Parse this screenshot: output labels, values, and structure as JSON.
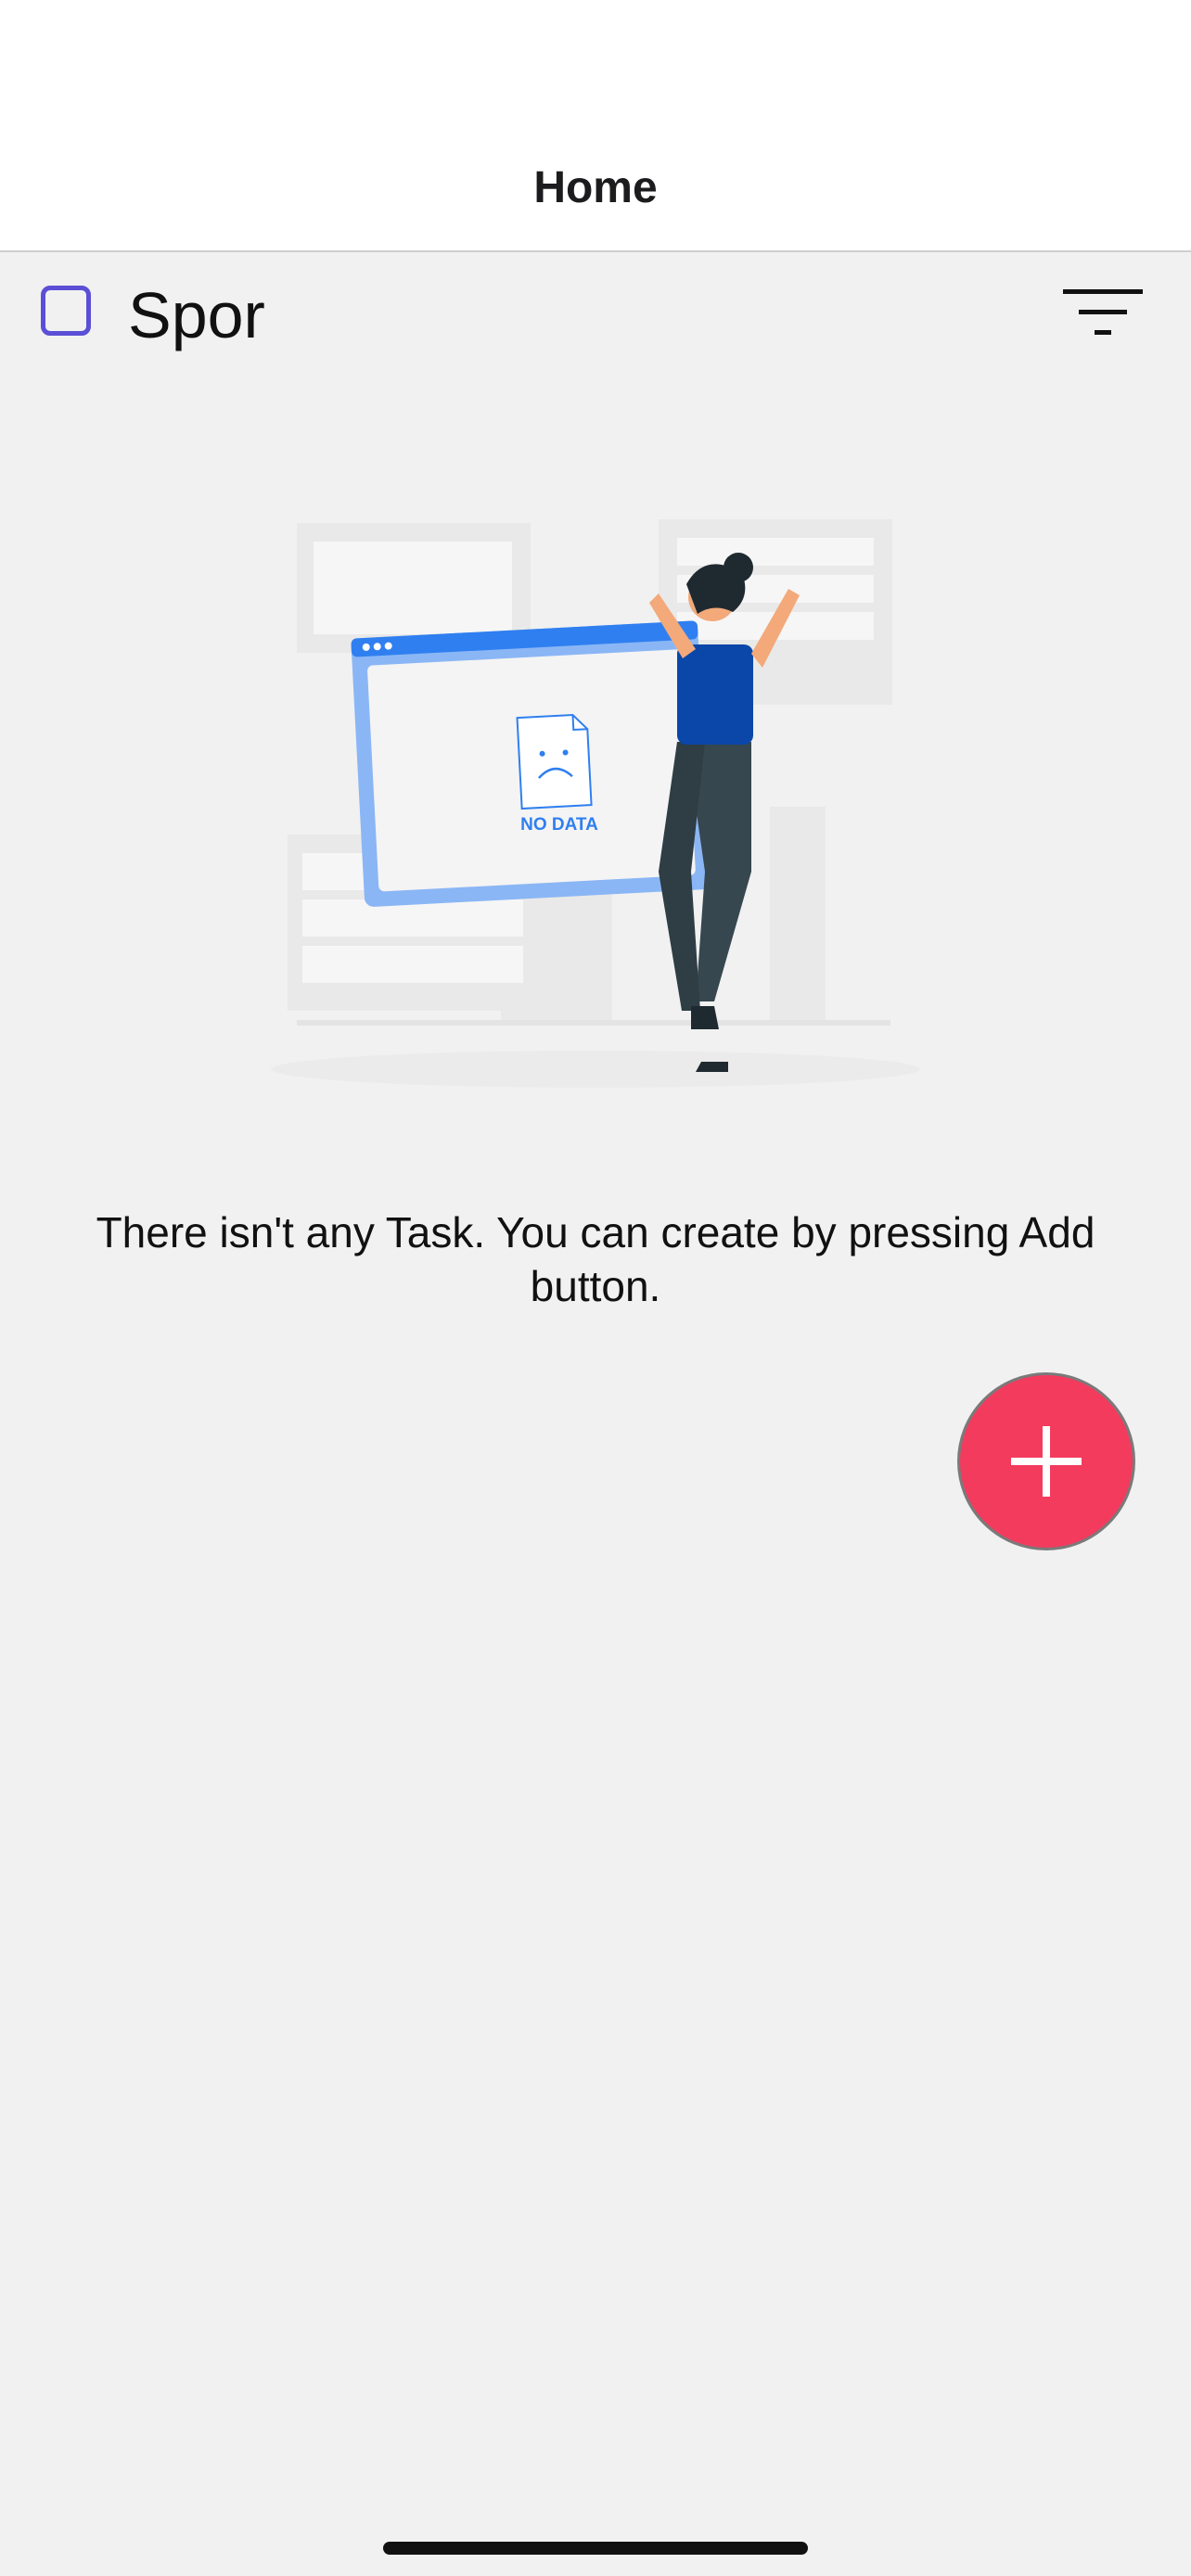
{
  "navbar": {
    "title": "Home"
  },
  "category": {
    "label": "Spor",
    "checked": false,
    "checkbox_color": "#5b4fd6"
  },
  "filter": {
    "icon": "filter-icon"
  },
  "illustration": {
    "caption": "NO DATA",
    "icon": "empty-state-illustration"
  },
  "empty_state": {
    "message": "There isn't any Task. You can create by pressing Add button."
  },
  "fab": {
    "icon": "plus-icon",
    "color": "#f33b5e"
  }
}
